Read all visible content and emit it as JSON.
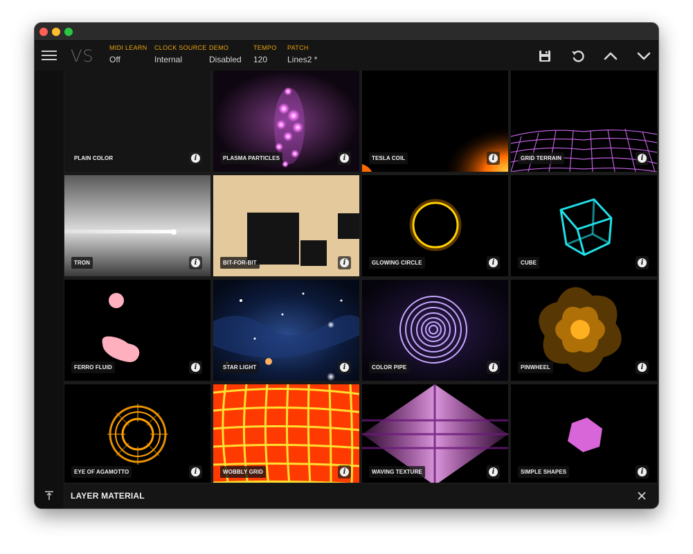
{
  "app": {
    "logo": "VS"
  },
  "params": [
    {
      "label": "MIDI LEARN",
      "value": "Off"
    },
    {
      "label": "CLOCK SOURCE",
      "value": "Internal"
    },
    {
      "label": "DEMO",
      "value": "Disabled"
    },
    {
      "label": "TEMPO",
      "value": "120"
    },
    {
      "label": "PATCH",
      "value": "Lines2 *"
    }
  ],
  "toolbar": {
    "icons": [
      "save-icon",
      "undo-icon",
      "chevron-up-icon",
      "chevron-down-icon"
    ]
  },
  "colors": {
    "accent": "#e8a20a",
    "background": "#111111",
    "tile_bg": "#000000"
  },
  "materials": [
    {
      "label": "PLAIN COLOR"
    },
    {
      "label": "PLASMA PARTICLES"
    },
    {
      "label": "TESLA COIL"
    },
    {
      "label": "GRID TERRAIN"
    },
    {
      "label": "TRON"
    },
    {
      "label": "BIT-FOR-BIT"
    },
    {
      "label": "GLOWING CIRCLE"
    },
    {
      "label": "CUBE"
    },
    {
      "label": "FERRO FLUID"
    },
    {
      "label": "STAR LIGHT"
    },
    {
      "label": "COLOR PIPE"
    },
    {
      "label": "PINWHEEL"
    },
    {
      "label": "EYE OF AGAMOTTO"
    },
    {
      "label": "WOBBLY GRID"
    },
    {
      "label": "WAVING TEXTURE"
    },
    {
      "label": "SIMPLE SHAPES"
    }
  ],
  "bottom": {
    "title": "LAYER MATERIAL"
  }
}
